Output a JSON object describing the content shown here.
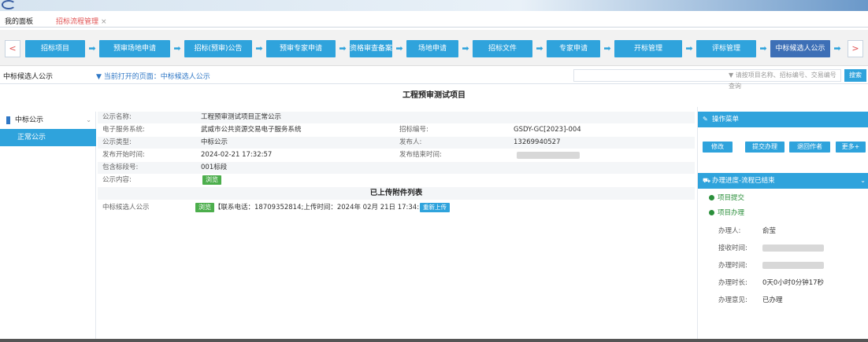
{
  "tabs": {
    "home": "我的面板",
    "active": "招标流程管理",
    "close": "×"
  },
  "flow": {
    "prev": "<",
    "next": ">",
    "steps": [
      "招标项目",
      "预审场地申请",
      "招标(预审)公告",
      "预审专家申请",
      "资格审查备案",
      "场地申请",
      "招标文件",
      "专家申请",
      "开标管理",
      "评标管理",
      "中标候选人公示"
    ]
  },
  "crumb": {
    "select_value": "中标候选人公示",
    "current_page": "▼ 当前打开的页面：中标候选人公示",
    "search_placeholder": "▼ 请按项目名称、招标编号、交易编号查询",
    "search_button": "搜索"
  },
  "page_title": "工程预审测试项目",
  "leftnav": {
    "group": "中标公示",
    "chevron": "⌄",
    "item": "正常公示"
  },
  "form": {
    "notice_name_label": "公示名称:",
    "notice_name_value": "工程预审测试项目正常公示",
    "system_label": "电子服务系统:",
    "system_value": "武威市公共资源交易电子服务系统",
    "bid_no_label": "招标编号:",
    "bid_no_value": "GSDY-GC[2023]-004",
    "type_label": "公示类型:",
    "type_value": "中标公示",
    "publisher_label": "发布人:",
    "publisher_value": "13269940527",
    "start_label": "发布开始时间:",
    "start_value": "2024-02-21 17:32:57",
    "end_label": "发布结束时间:",
    "section_label": "包含标段号:",
    "section_value": "001标段",
    "content_label": "公示内容:",
    "browse": "浏览"
  },
  "attachments": {
    "title": "已上传附件列表",
    "row_label": "中标候选人公示",
    "browse": "浏览",
    "info": "【联系电话：18709352814;上传时间：2024年 02月 21日 17:34:11】",
    "reupload": "重新上传"
  },
  "right": {
    "ops_title": "操作菜单",
    "ops_buttons": [
      "修改",
      "提交办理",
      "退回作者",
      "更多+"
    ],
    "progress_title": "办理进度-流程已结束",
    "steps": [
      "项目提交",
      "项目办理"
    ],
    "handler_label": "办理人:",
    "handler_value": "俞莹",
    "recv_label": "接收时间:",
    "do_label": "办理时间:",
    "dur_label": "办理时长:",
    "dur_value": "0天0小时0分钟17秒",
    "opinion_label": "办理意见:",
    "opinion_value": "已办理"
  }
}
